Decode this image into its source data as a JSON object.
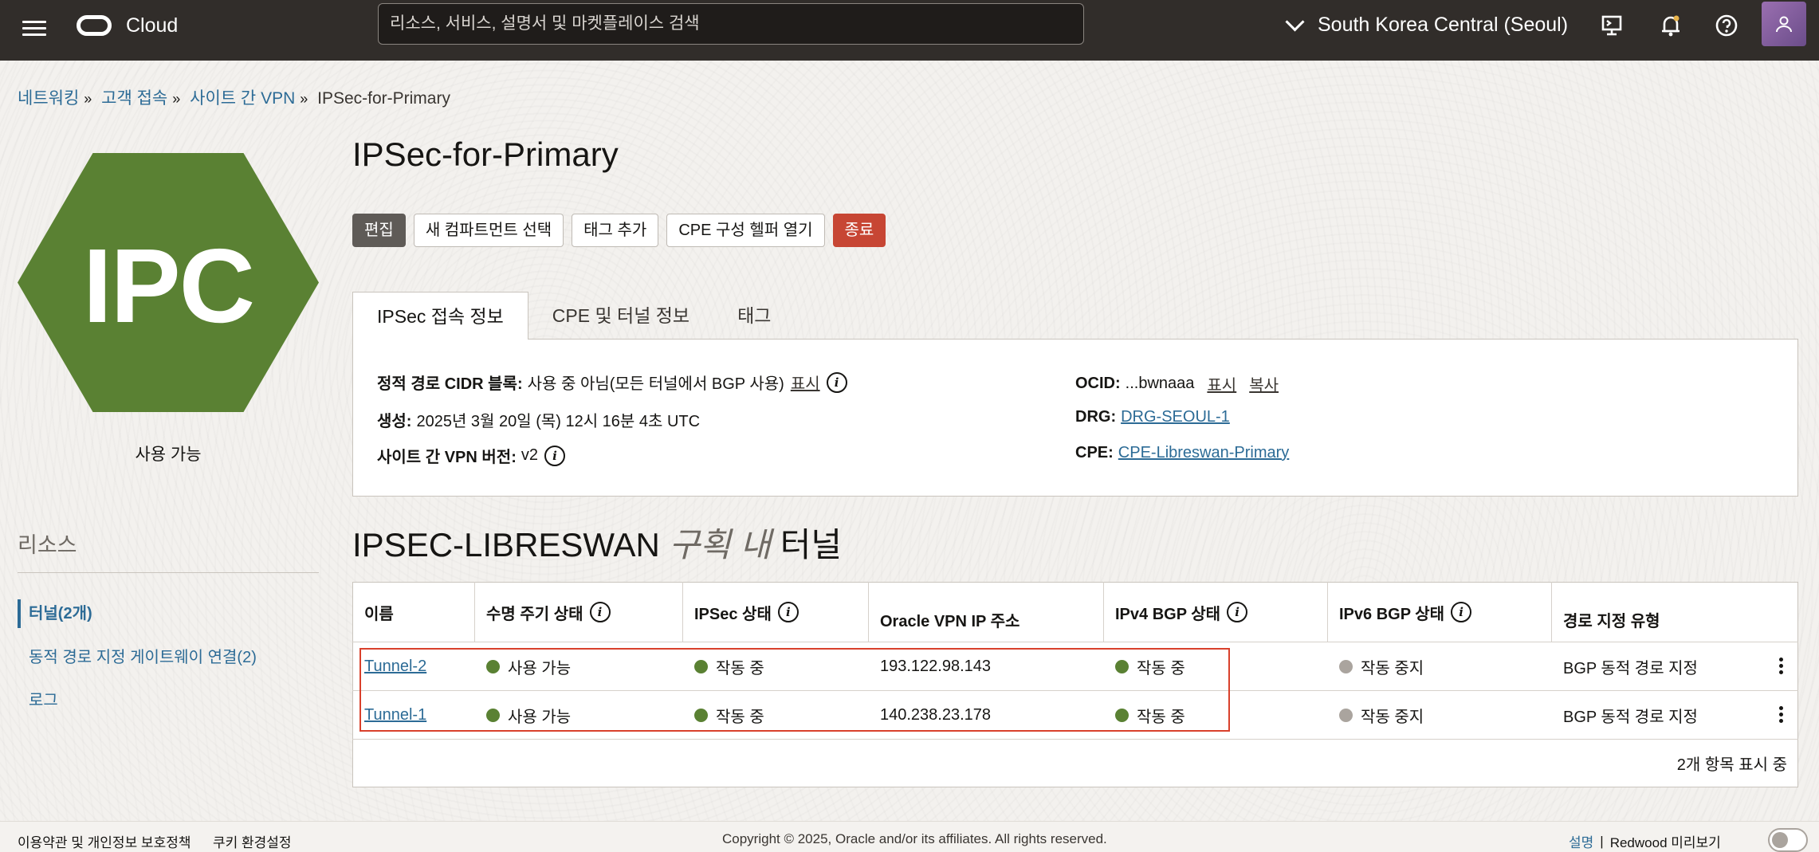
{
  "header": {
    "logo_text": "Cloud",
    "search_placeholder": "리소스, 서비스, 설명서 및 마켓플레이스 검색",
    "region": "South Korea Central (Seoul)"
  },
  "breadcrumb": [
    "네트워킹",
    "고객 접속",
    "사이트 간 VPN",
    "IPSec-for-Primary"
  ],
  "resource_badge": {
    "text": "IPC",
    "status": "사용 가능",
    "color": "#5a8133"
  },
  "page_title": "IPSec-for-Primary",
  "actions": [
    "편집",
    "새 컴파트먼트 선택",
    "태그 추가",
    "CPE 구성 헬퍼 열기",
    "종료"
  ],
  "tabs": [
    "IPSec 접속 정보",
    "CPE 및 터널 정보",
    "태그"
  ],
  "info": {
    "static_label": "정적 경로 CIDR 블록:",
    "static_value": "사용 중 아님(모든 터널에서 BGP 사용)",
    "static_link": "표시",
    "created_label": "생성:",
    "created_value": "2025년 3월 20일 (목) 12시 16분 4초 UTC",
    "version_label": "사이트 간 VPN 버전:",
    "version_value": "v2",
    "ocid_label": "OCID:",
    "ocid_value": "...bwnaaa",
    "ocid_show": "표시",
    "ocid_copy": "복사",
    "drg_label": "DRG:",
    "drg_value": "DRG-SEOUL-1",
    "cpe_label": "CPE:",
    "cpe_value": "CPE-Libreswan-Primary"
  },
  "section": {
    "title_a": "IPSEC-LIBRESWAN",
    "title_b": "구획 내",
    "title_c": "터널"
  },
  "table": {
    "headers": [
      "이름",
      "수명 주기 상태",
      "IPSec 상태",
      "Oracle VPN IP 주소",
      "IPv4 BGP 상태",
      "IPv6 BGP 상태",
      "경로 지정 유형"
    ],
    "rows": [
      {
        "name": "Tunnel-2",
        "lifecycle": "사용 가능",
        "ipsec": "작동 중",
        "ip": "193.122.98.143",
        "ipv4": "작동 중",
        "ipv6": "작동 중지",
        "routing": "BGP 동적 경로 지정"
      },
      {
        "name": "Tunnel-1",
        "lifecycle": "사용 가능",
        "ipsec": "작동 중",
        "ip": "140.238.23.178",
        "ipv4": "작동 중",
        "ipv6": "작동 중지",
        "routing": "BGP 동적 경로 지정"
      }
    ],
    "count_text": "2개 항목 표시 중"
  },
  "resources": {
    "title": "리소스",
    "items": [
      "터널(2개)",
      "동적 경로 지정 게이트웨이 연결(2)",
      "로그"
    ]
  },
  "footer": {
    "terms": "이용약관 및 개인정보 보호정책",
    "cookies": "쿠키 환경설정",
    "copyright": "Copyright © 2025, Oracle and/or its affiliates. All rights reserved.",
    "help": "설명",
    "redwood": "Redwood 미리보기"
  },
  "colors": {
    "header_bg": "#312d2a",
    "link": "#2c6b96",
    "danger": "#c74634",
    "running": "#5a8133",
    "stopped": "#aaa49e"
  }
}
